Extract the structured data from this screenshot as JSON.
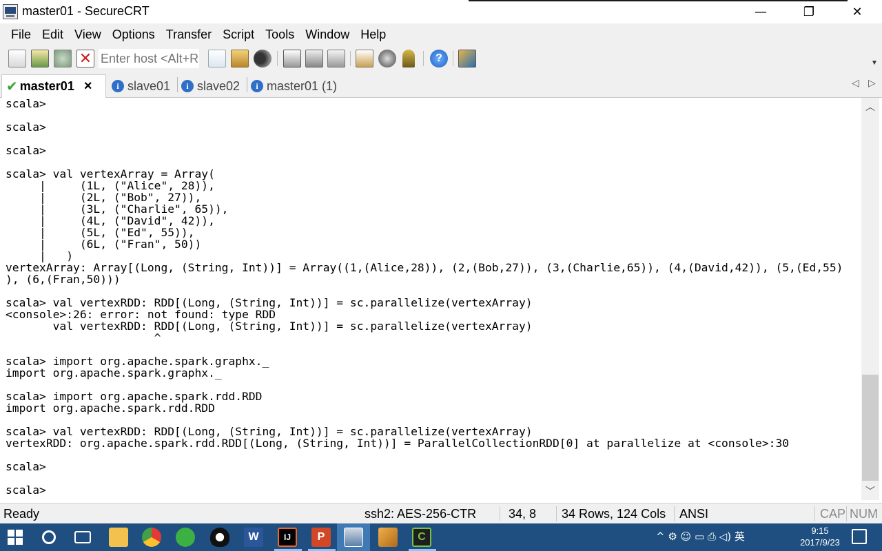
{
  "window": {
    "title": "master01 - SecureCRT",
    "minimize": "—",
    "maximize": "❐",
    "close": "✕"
  },
  "menu": [
    "File",
    "Edit",
    "View",
    "Options",
    "Transfer",
    "Script",
    "Tools",
    "Window",
    "Help"
  ],
  "toolbar": {
    "host_placeholder": "Enter host <Alt+R>",
    "icons": [
      "connect-bar-icon",
      "quick-connect-icon",
      "reconnect-icon",
      "disconnect-icon",
      "copy-icon",
      "paste-icon",
      "find-icon",
      "print-setup-icon",
      "print-selection-icon",
      "print-icon",
      "session-options-icon",
      "global-options-icon",
      "key-icon",
      "help-icon",
      "screenshot-icon"
    ]
  },
  "tabs": [
    {
      "label": "master01",
      "active": true,
      "close": "×"
    },
    {
      "label": "slave01",
      "active": false
    },
    {
      "label": "slave02",
      "active": false
    },
    {
      "label": "master01 (1)",
      "active": false
    }
  ],
  "terminal": {
    "lines": [
      "scala>",
      "",
      "scala>",
      "",
      "scala>",
      "",
      "scala> val vertexArray = Array(",
      "     |     (1L, (\"Alice\", 28)),",
      "     |     (2L, (\"Bob\", 27)),",
      "     |     (3L, (\"Charlie\", 65)),",
      "     |     (4L, (\"David\", 42)),",
      "     |     (5L, (\"Ed\", 55)),",
      "     |     (6L, (\"Fran\", 50))",
      "     |   )",
      "vertexArray: Array[(Long, (String, Int))] = Array((1,(Alice,28)), (2,(Bob,27)), (3,(Charlie,65)), (4,(David,42)), (5,(Ed,55)",
      "), (6,(Fran,50)))",
      "",
      "scala> val vertexRDD: RDD[(Long, (String, Int))] = sc.parallelize(vertexArray)",
      "<console>:26: error: not found: type RDD",
      "       val vertexRDD: RDD[(Long, (String, Int))] = sc.parallelize(vertexArray)",
      "                      ^",
      "",
      "scala> import org.apache.spark.graphx._",
      "import org.apache.spark.graphx._",
      "",
      "scala> import org.apache.spark.rdd.RDD",
      "import org.apache.spark.rdd.RDD",
      "",
      "scala> val vertexRDD: RDD[(Long, (String, Int))] = sc.parallelize(vertexArray)",
      "vertexRDD: org.apache.spark.rdd.RDD[(Long, (String, Int))] = ParallelCollectionRDD[0] at parallelize at <console>:30",
      "",
      "scala>",
      "",
      "scala>"
    ]
  },
  "status": {
    "state": "Ready",
    "encryption": "ssh2: AES-256-CTR",
    "cursor": "34,  8",
    "size": "34 Rows, 124 Cols",
    "emulation": "ANSI",
    "caps": "CAP",
    "num": "NUM"
  },
  "taskbar": {
    "apps": [
      "start-icon",
      "cortana-icon",
      "task-view-icon",
      "file-explorer-icon",
      "chrome-icon",
      "wechat-icon",
      "qq-icon",
      "word-icon",
      "intellij-icon",
      "powerpoint-icon",
      "securecrt-icon",
      "notebook-icon",
      "cmder-icon"
    ],
    "tray_text": "^  ⚙ ☺ ▭ ⎙ ◁) 英",
    "time": "9:15",
    "date": "2017/9/23"
  },
  "colors": {
    "taskbar": "#1f4f80",
    "taskbar_active": "#3f7ab5",
    "chrome_bg": "#f0f0f0",
    "tab_icon": "#2f6fc8",
    "check": "#3aa23a"
  }
}
